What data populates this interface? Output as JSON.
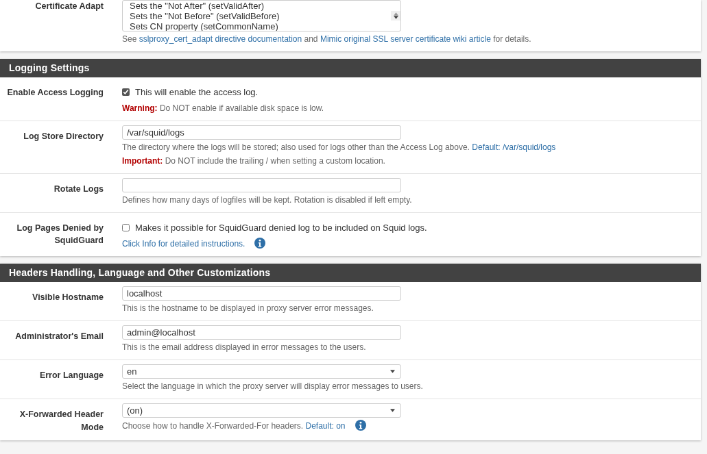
{
  "sections": [
    {
      "rows": [
        {
          "label": "Certificate Adapt",
          "kind": "listbox",
          "options": [
            "Sets the \"Not After\" (setValidAfter)",
            "Sets the \"Not Before\" (setValidBefore)",
            "Sets CN property (setCommonName)"
          ],
          "help": [
            [
              {
                "kind": "plain",
                "text": "See"
              },
              {
                "kind": "link",
                "text": "sslproxy_cert_adapt directive documentation"
              },
              {
                "kind": "plain",
                "text": "and"
              },
              {
                "kind": "link",
                "text": "Mimic original SSL server certificate wiki article"
              },
              {
                "kind": "plain",
                "text": "for details."
              }
            ]
          ]
        }
      ]
    },
    {
      "title": "Logging Settings",
      "rows": [
        {
          "label": "Enable Access Logging",
          "kind": "checkbox",
          "checked": true,
          "text": "This will enable the access log.",
          "help": [
            [
              {
                "kind": "alert",
                "text": "Warning:"
              },
              {
                "kind": "plain",
                "text": "Do NOT enable if available disk space is low."
              }
            ]
          ]
        },
        {
          "label": "Log Store Directory",
          "kind": "input",
          "value": "/var/squid/logs",
          "help": [
            [
              {
                "kind": "plain",
                "text": "The directory where the logs will be stored; also used for logs other than the Access Log above."
              },
              {
                "kind": "link",
                "text": "Default: /var/squid/logs"
              }
            ],
            [
              {
                "kind": "alert",
                "text": "Important:"
              },
              {
                "kind": "plain",
                "text": "Do NOT include the trailing / when setting a custom location."
              }
            ]
          ]
        },
        {
          "label": "Rotate Logs",
          "kind": "input",
          "help": [
            [
              {
                "kind": "plain",
                "text": "Defines how many days of logfiles will be kept. Rotation is disabled if left empty."
              }
            ]
          ]
        },
        {
          "label": "Log Pages Denied by SquidGuard",
          "kind": "checkbox",
          "checked": false,
          "text": "Makes it possible for SquidGuard denied log to be included on Squid logs.",
          "info": true,
          "help": [
            [
              {
                "kind": "link",
                "text": "Click Info for detailed instructions."
              }
            ]
          ]
        }
      ]
    },
    {
      "title": "Headers Handling, Language and Other Customizations",
      "rows": [
        {
          "label": "Visible Hostname",
          "kind": "input",
          "value": "localhost",
          "help": [
            [
              {
                "kind": "plain",
                "text": "This is the hostname to be displayed in proxy server error messages."
              }
            ]
          ]
        },
        {
          "label": "Administrator's Email",
          "kind": "input",
          "value": "admin@localhost",
          "help": [
            [
              {
                "kind": "plain",
                "text": "This is the email address displayed in error messages to the users."
              }
            ]
          ]
        },
        {
          "label": "Error Language",
          "kind": "select",
          "value": "en",
          "help": [
            [
              {
                "kind": "plain",
                "text": "Select the language in which the proxy server will display error messages to users."
              }
            ]
          ]
        },
        {
          "label": "X-Forwarded Header Mode",
          "kind": "select",
          "value": "(on)",
          "info": true,
          "help": [
            [
              {
                "kind": "plain",
                "text": "Choose how to handle X-Forwarded-For headers."
              },
              {
                "kind": "link",
                "text": "Default: on"
              }
            ]
          ]
        }
      ]
    }
  ]
}
